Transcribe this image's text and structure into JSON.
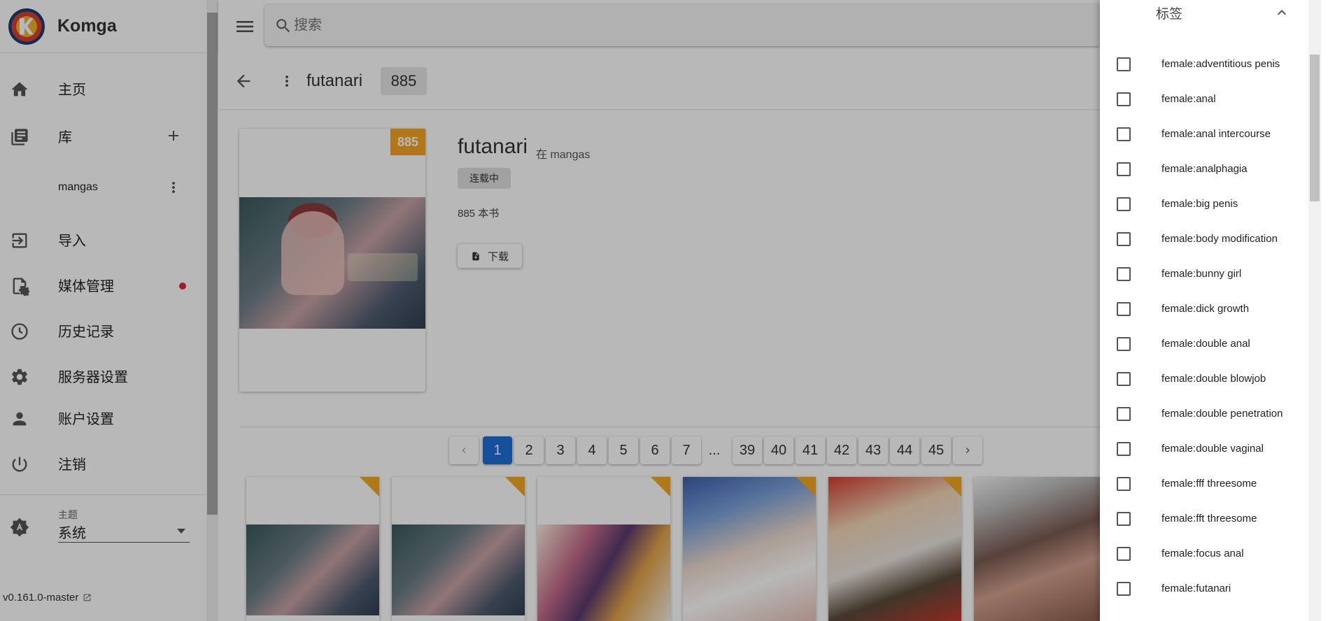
{
  "app": {
    "name": "Komga",
    "version": "v0.161.0-master"
  },
  "sidebar": {
    "items": [
      {
        "label": "主页"
      },
      {
        "label": "库"
      },
      {
        "label": "mangas"
      },
      {
        "label": "导入"
      },
      {
        "label": "媒体管理"
      },
      {
        "label": "历史记录"
      },
      {
        "label": "服务器设置"
      },
      {
        "label": "账户设置"
      },
      {
        "label": "注销"
      }
    ],
    "theme": {
      "caption": "主题",
      "value": "系统"
    }
  },
  "search": {
    "placeholder": "搜索"
  },
  "series": {
    "title": "futanari",
    "count": "885",
    "cover_badge": "885",
    "in_library": "在 mangas",
    "status": "连载中",
    "book_count": "885 本书",
    "download_label": "下载"
  },
  "pagination": {
    "pages": [
      "1",
      "2",
      "3",
      "4",
      "5",
      "6",
      "7",
      "...",
      "39",
      "40",
      "41",
      "42",
      "43",
      "44",
      "45"
    ],
    "active": "1"
  },
  "filter_panel": {
    "title": "标签",
    "tags": [
      "female:adventitious penis",
      "female:anal",
      "female:anal intercourse",
      "female:analphagia",
      "female:big penis",
      "female:body modification",
      "female:bunny girl",
      "female:dick growth",
      "female:double anal",
      "female:double blowjob",
      "female:double penetration",
      "female:double vaginal",
      "female:fff threesome",
      "female:fft threesome",
      "female:focus anal",
      "female:futanari"
    ]
  },
  "colors": {
    "accent": "#1e6fd9",
    "badge": "#f5a623",
    "notify": "#e52535"
  },
  "icons": [
    "menu-icon",
    "search-icon",
    "home-icon",
    "library-icon",
    "plus-icon",
    "more-vert-icon",
    "import-icon",
    "media-management-icon",
    "history-icon",
    "settings-icon",
    "account-icon",
    "logout-icon",
    "theme-icon",
    "external-link-icon",
    "arrow-back-icon",
    "download-icon",
    "chevron-left-icon",
    "chevron-right-icon",
    "chevron-up-icon"
  ]
}
